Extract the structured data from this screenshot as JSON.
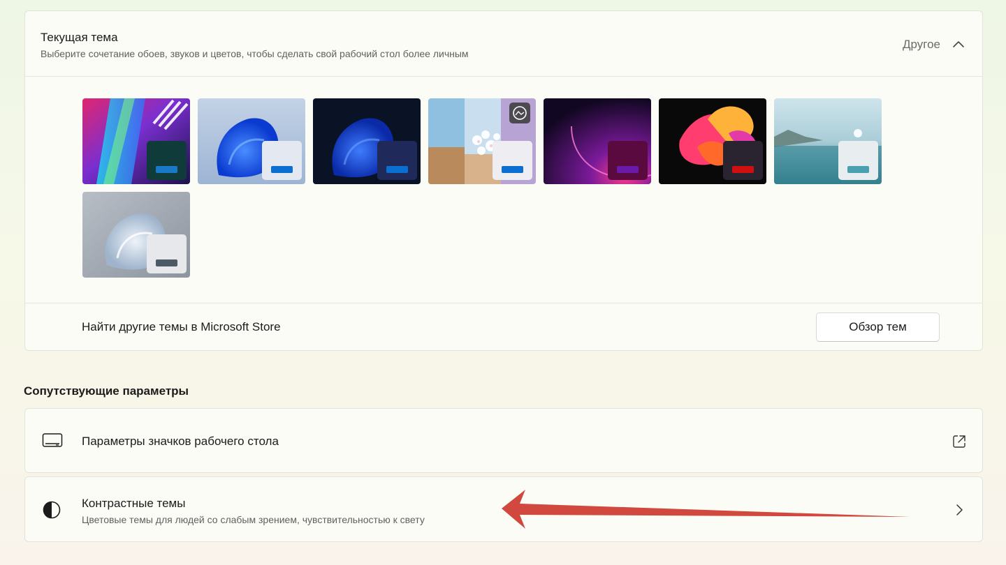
{
  "current_theme": {
    "title": "Текущая тема",
    "subtitle": "Выберите сочетание обоев, звуков и цветов, чтобы сделать свой рабочий стол более личным",
    "value": "Другое",
    "collapse_icon": "chevron-up-icon"
  },
  "themes": [
    {
      "name": "glow",
      "window_color": "#0f3b3a",
      "bar_color": "#1a78c8"
    },
    {
      "name": "windows-light",
      "window_color": "#e4e8f0",
      "bar_color": "#0a6fd1"
    },
    {
      "name": "windows-dark",
      "window_color": "#1f2a5a",
      "bar_color": "#0a6fd1"
    },
    {
      "name": "spotlight",
      "window_color": "#eeeef2",
      "bar_color": "#0a6fd1",
      "badge_icon": "spotlight-icon"
    },
    {
      "name": "sunrise",
      "window_color": "#5a0a3e",
      "bar_color": "#6a1aa8"
    },
    {
      "name": "flow",
      "window_color": "#2a2430",
      "bar_color": "#d01010"
    },
    {
      "name": "captured-motion",
      "window_color": "#e8eef0",
      "bar_color": "#4aa0b0"
    },
    {
      "name": "windows-gray",
      "window_color": "#e6e8ec",
      "bar_color": "#4d5a66"
    }
  ],
  "store": {
    "text": "Найти другие темы в Microsoft Store",
    "button": "Обзор тем"
  },
  "related": {
    "heading": "Сопутствующие параметры",
    "desktop_icons": {
      "label": "Параметры значков рабочего стола",
      "icon": "monitor-icon",
      "action_icon": "external-link-icon"
    },
    "contrast_themes": {
      "label": "Контрастные темы",
      "sublabel": "Цветовые темы для людей со слабым зрением, чувствительностью к свету",
      "icon": "contrast-icon",
      "action_icon": "chevron-right-icon"
    }
  },
  "colors": {
    "accent_arrow": "#d0483e"
  }
}
